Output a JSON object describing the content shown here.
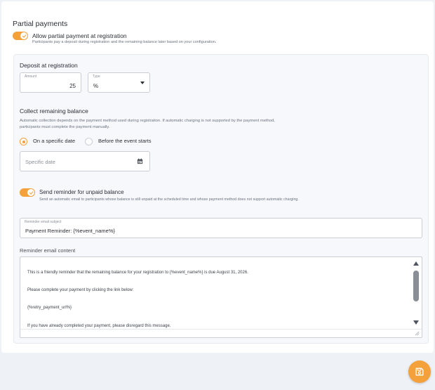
{
  "colors": {
    "accent": "#f4a13b",
    "panel_bg": "#f6f8fc",
    "page_bg": "#eef1f6"
  },
  "partial": {
    "title": "Partial payments",
    "toggle_label": "Allow partial payment at registration",
    "toggle_help": "Participants pay a deposit during registration and the remaining balance later based on your configuration.",
    "toggle_on": true
  },
  "deposit": {
    "title": "Deposit at registration",
    "amount_label": "Amount",
    "amount_value": "25",
    "type_label": "Type",
    "type_value": "%"
  },
  "collect": {
    "title": "Collect remaining balance",
    "description": "Automatic collection depends on the payment method used during registration. If automatic charging is not supported by the payment method, participants must complete the payment manually.",
    "options": [
      {
        "label": "On a specific date",
        "selected": true
      },
      {
        "label": "Before the event starts",
        "selected": false
      }
    ],
    "date_placeholder": "Specific date",
    "date_icon": "calendar-icon"
  },
  "reminder": {
    "toggle_label": "Send reminder for unpaid balance",
    "toggle_help": "Send an automatic email to participants whose balance is still unpaid at the scheduled time and whose payment method does not support automatic charging.",
    "toggle_on": true,
    "subject_label": "Reminder email subject",
    "subject_value": "Payment Reminder: {%event_name%}",
    "content_label": "Reminder email content",
    "content_paragraphs": [
      "This is a friendly reminder that the remaining balance for your registration to {%event_name%} is due August 31, 2026.",
      "Please complete your payment by clicking the link below:",
      "{%retry_payment_url%}",
      "If you have already completed your payment, please disregard this message."
    ]
  },
  "save_button": {
    "icon": "save-icon"
  }
}
